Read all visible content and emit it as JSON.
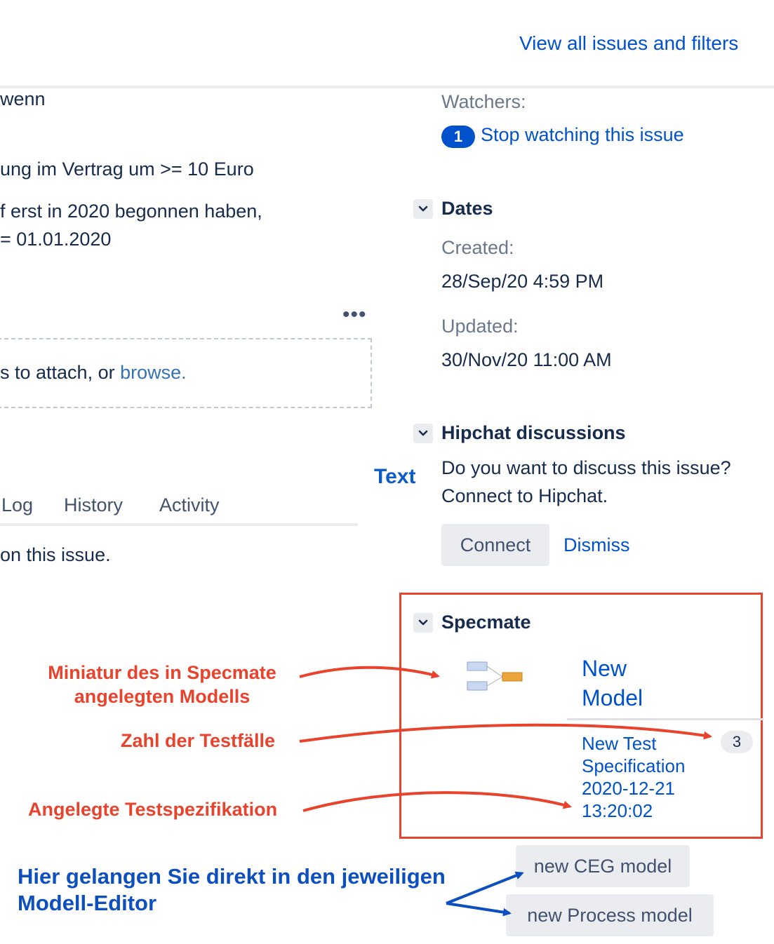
{
  "header": {
    "view_all_link": "View all issues and filters"
  },
  "description": {
    "line1": "wenn",
    "line2": "ung im Vertrag um >= 10 Euro",
    "line3": "f erst in 2020 begonnen haben,",
    "line4": "= 01.01.2020"
  },
  "attachments": {
    "more_label": "•••",
    "drop_text": "s to attach, or ",
    "browse_link": "browse."
  },
  "activity": {
    "tabs": [
      "Log",
      "History",
      "Activity"
    ],
    "empty_text": "on this issue."
  },
  "sidebar": {
    "watchers_label": "Watchers:",
    "watchers_count": "1",
    "stop_watching_link": "Stop watching this issue",
    "dates": {
      "title": "Dates",
      "created_label": "Created:",
      "created_value": "28/Sep/20 4:59 PM",
      "updated_label": "Updated:",
      "updated_value": "30/Nov/20 11:00 AM"
    },
    "hipchat": {
      "title": "Hipchat discussions",
      "line1": "Do you want to discuss this issue?",
      "line2": "Connect to Hipchat.",
      "connect_button": "Connect",
      "dismiss_link": "Dismiss"
    },
    "specmate": {
      "title": "Specmate",
      "model_line1": "New",
      "model_line2": "Model",
      "testspec_lines": [
        "New Test",
        "Specification",
        "2020-12-21",
        "13:20:02"
      ],
      "testcase_count": "3",
      "new_ceg_button": "new CEG model",
      "new_process_button": "new Process model"
    }
  },
  "annotations": {
    "text_tag": "Text",
    "miniatur_line1": "Miniatur des in Specmate",
    "miniatur_line2": "angelegten Modells",
    "zahl": "Zahl der Testfälle",
    "angelegte": "Angelegte Testspezifikation",
    "hier_line1": "Hier gelangen Sie direkt in den jeweiligen",
    "hier_line2": "Modell-Editor"
  },
  "colors": {
    "link": "#0052cc",
    "annotation_red": "#e8432d",
    "annotation_blue": "#0d4fbf",
    "badge": "#0052cc"
  }
}
